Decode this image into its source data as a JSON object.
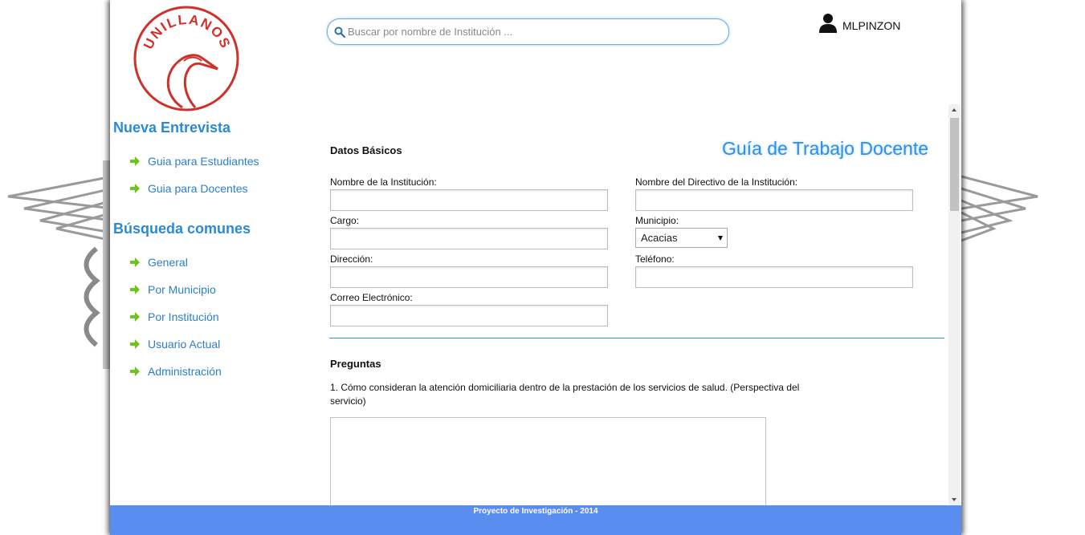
{
  "brand": {
    "logo_text": "UNILLANOS"
  },
  "search": {
    "placeholder": "Buscar por nombre de Institución ..."
  },
  "user": {
    "name": "MLPINZON"
  },
  "sidebar": {
    "new_interview_heading": "Nueva Entrevista",
    "new_interview_items": [
      {
        "label": "Guia para Estudiantes"
      },
      {
        "label": "Guia para Docentes"
      }
    ],
    "common_search_heading": "Búsqueda comunes",
    "common_search_items": [
      {
        "label": "General"
      },
      {
        "label": "Por Municipio"
      },
      {
        "label": "Por Institución"
      },
      {
        "label": "Usuario Actual"
      },
      {
        "label": "Administración"
      }
    ]
  },
  "form": {
    "section_basic": "Datos Básicos",
    "guide_title": "Guía de Trabajo Docente",
    "fields": {
      "institution_name": {
        "label": "Nombre de la Institución:",
        "value": ""
      },
      "director_name": {
        "label": "Nombre del Directivo de la Institución:",
        "value": ""
      },
      "position": {
        "label": "Cargo:",
        "value": ""
      },
      "municipality": {
        "label": "Municipio:",
        "value": "Acacias"
      },
      "address": {
        "label": "Dirección:",
        "value": ""
      },
      "phone": {
        "label": "Teléfono:",
        "value": ""
      },
      "email": {
        "label": "Correo Electrónico:",
        "value": ""
      }
    },
    "section_questions": "Preguntas",
    "questions": [
      {
        "text": "1. Cómo consideran la atención domiciliaria dentro de la prestación de los servicios de salud. (Perspectiva del servicio)",
        "answer": ""
      }
    ]
  },
  "footer": {
    "text": "Proyecto de Investigación - 2014"
  },
  "colors": {
    "accent": "#2b8ad8",
    "footer_bg": "#5a8df0",
    "logo_red": "#d0302a",
    "arrow_green": "#6cc51a"
  }
}
